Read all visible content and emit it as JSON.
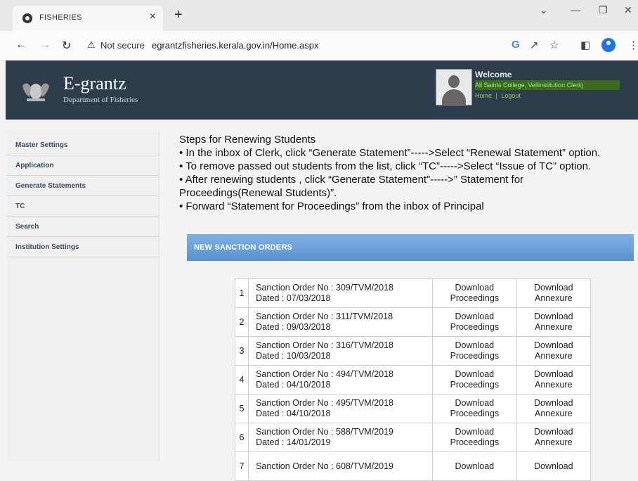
{
  "browser": {
    "tab_title": "FISHERIES",
    "tab_close": "×",
    "new_tab": "+",
    "security_label": "Not secure",
    "url": "egrantzfisheries.kerala.gov.in/Home.aspx"
  },
  "header": {
    "logo_title": "E-grantz",
    "logo_subtitle": "Department of Fisheries",
    "welcome": "Welcome",
    "college": "All Saints College, Vellinstitution Clerk)",
    "home_link": "Home",
    "separator": "|",
    "logout_link": "Logout"
  },
  "sidebar": {
    "items": [
      {
        "label": "Master Settings"
      },
      {
        "label": "Application"
      },
      {
        "label": "Generate Statements"
      },
      {
        "label": "TC"
      },
      {
        "label": "Search"
      },
      {
        "label": "Institution Settings"
      }
    ]
  },
  "steps": {
    "title": "Steps for Renewing Students",
    "line1": "• In the inbox of Clerk, click “Generate Statement”----->Select “Renewal Statement” option.",
    "line2": "• To remove passed out students from the list, click “TC”----->Select “Issue of TC” option.",
    "line3a": "• After renewing students , click “Generate Statement”----->” Statement for",
    "line3b": "Proceedings(Renewal Students)”.",
    "line4": "• Forward “Statement for Proceedings” from the inbox of Principal"
  },
  "sanction": {
    "banner": "NEW SANCTION ORDERS",
    "rows": [
      {
        "num": "1",
        "order": "Sanction Order No : 309/TVM/2018",
        "date": "Dated : 07/03/2018",
        "proc1": "Download",
        "proc2": "Proceedings",
        "ann1": "Download",
        "ann2": "Annexure"
      },
      {
        "num": "2",
        "order": "Sanction Order No : 311/TVM/2018",
        "date": "Dated : 09/03/2018",
        "proc1": "Download",
        "proc2": "Proceedings",
        "ann1": "Download",
        "ann2": "Annexure"
      },
      {
        "num": "3",
        "order": "Sanction Order No : 316/TVM/2018",
        "date": "Dated : 10/03/2018",
        "proc1": "Download",
        "proc2": "Proceedings",
        "ann1": "Download",
        "ann2": "Annexure"
      },
      {
        "num": "4",
        "order": "Sanction Order No : 494/TVM/2018",
        "date": "Dated : 04/10/2018",
        "proc1": "Download",
        "proc2": "Proceedings",
        "ann1": "Download",
        "ann2": "Annexure"
      },
      {
        "num": "5",
        "order": "Sanction Order No : 495/TVM/2018",
        "date": "Dated : 04/10/2018",
        "proc1": "Download",
        "proc2": "Proceedings",
        "ann1": "Download",
        "ann2": "Annexure"
      },
      {
        "num": "6",
        "order": "Sanction Order No : 588/TVM/2019",
        "date": "Dated : 14/01/2019",
        "proc1": "Download",
        "proc2": "Proceedings",
        "ann1": "Download",
        "ann2": "Annexure"
      },
      {
        "num": "7",
        "order": "Sanction Order No : 608/TVM/2019",
        "date": "",
        "proc1": "Download",
        "proc2": "",
        "ann1": "Download",
        "ann2": ""
      }
    ]
  }
}
